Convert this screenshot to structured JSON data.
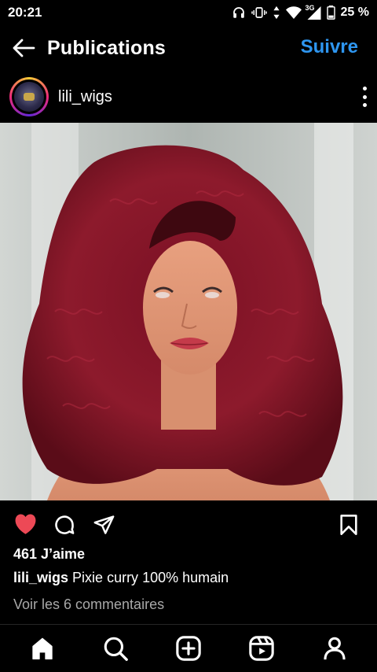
{
  "status": {
    "time": "20:21",
    "network": "3G",
    "battery": "25 %",
    "icons": [
      "headphones-icon",
      "vibrate-icon",
      "data-arrows-icon",
      "wifi-icon",
      "signal-icon",
      "battery-icon"
    ]
  },
  "header": {
    "title": "Publications",
    "follow_label": "Suivre",
    "back_icon": "arrow-left-icon",
    "accent": "#2e96f0"
  },
  "post": {
    "username": "lili_wigs",
    "image_alt": "burgundy curly lace wig on mannequin",
    "likes": "461 J’aime",
    "caption_user": "lili_wigs",
    "caption_text": "Pixie curry 100% humain",
    "comments_link": "Voir les 6 commentaires",
    "liked": true,
    "like_color": "#ed4956"
  },
  "nav": {
    "items": [
      "home-icon",
      "search-icon",
      "create-icon",
      "reels-icon",
      "profile-icon"
    ]
  }
}
